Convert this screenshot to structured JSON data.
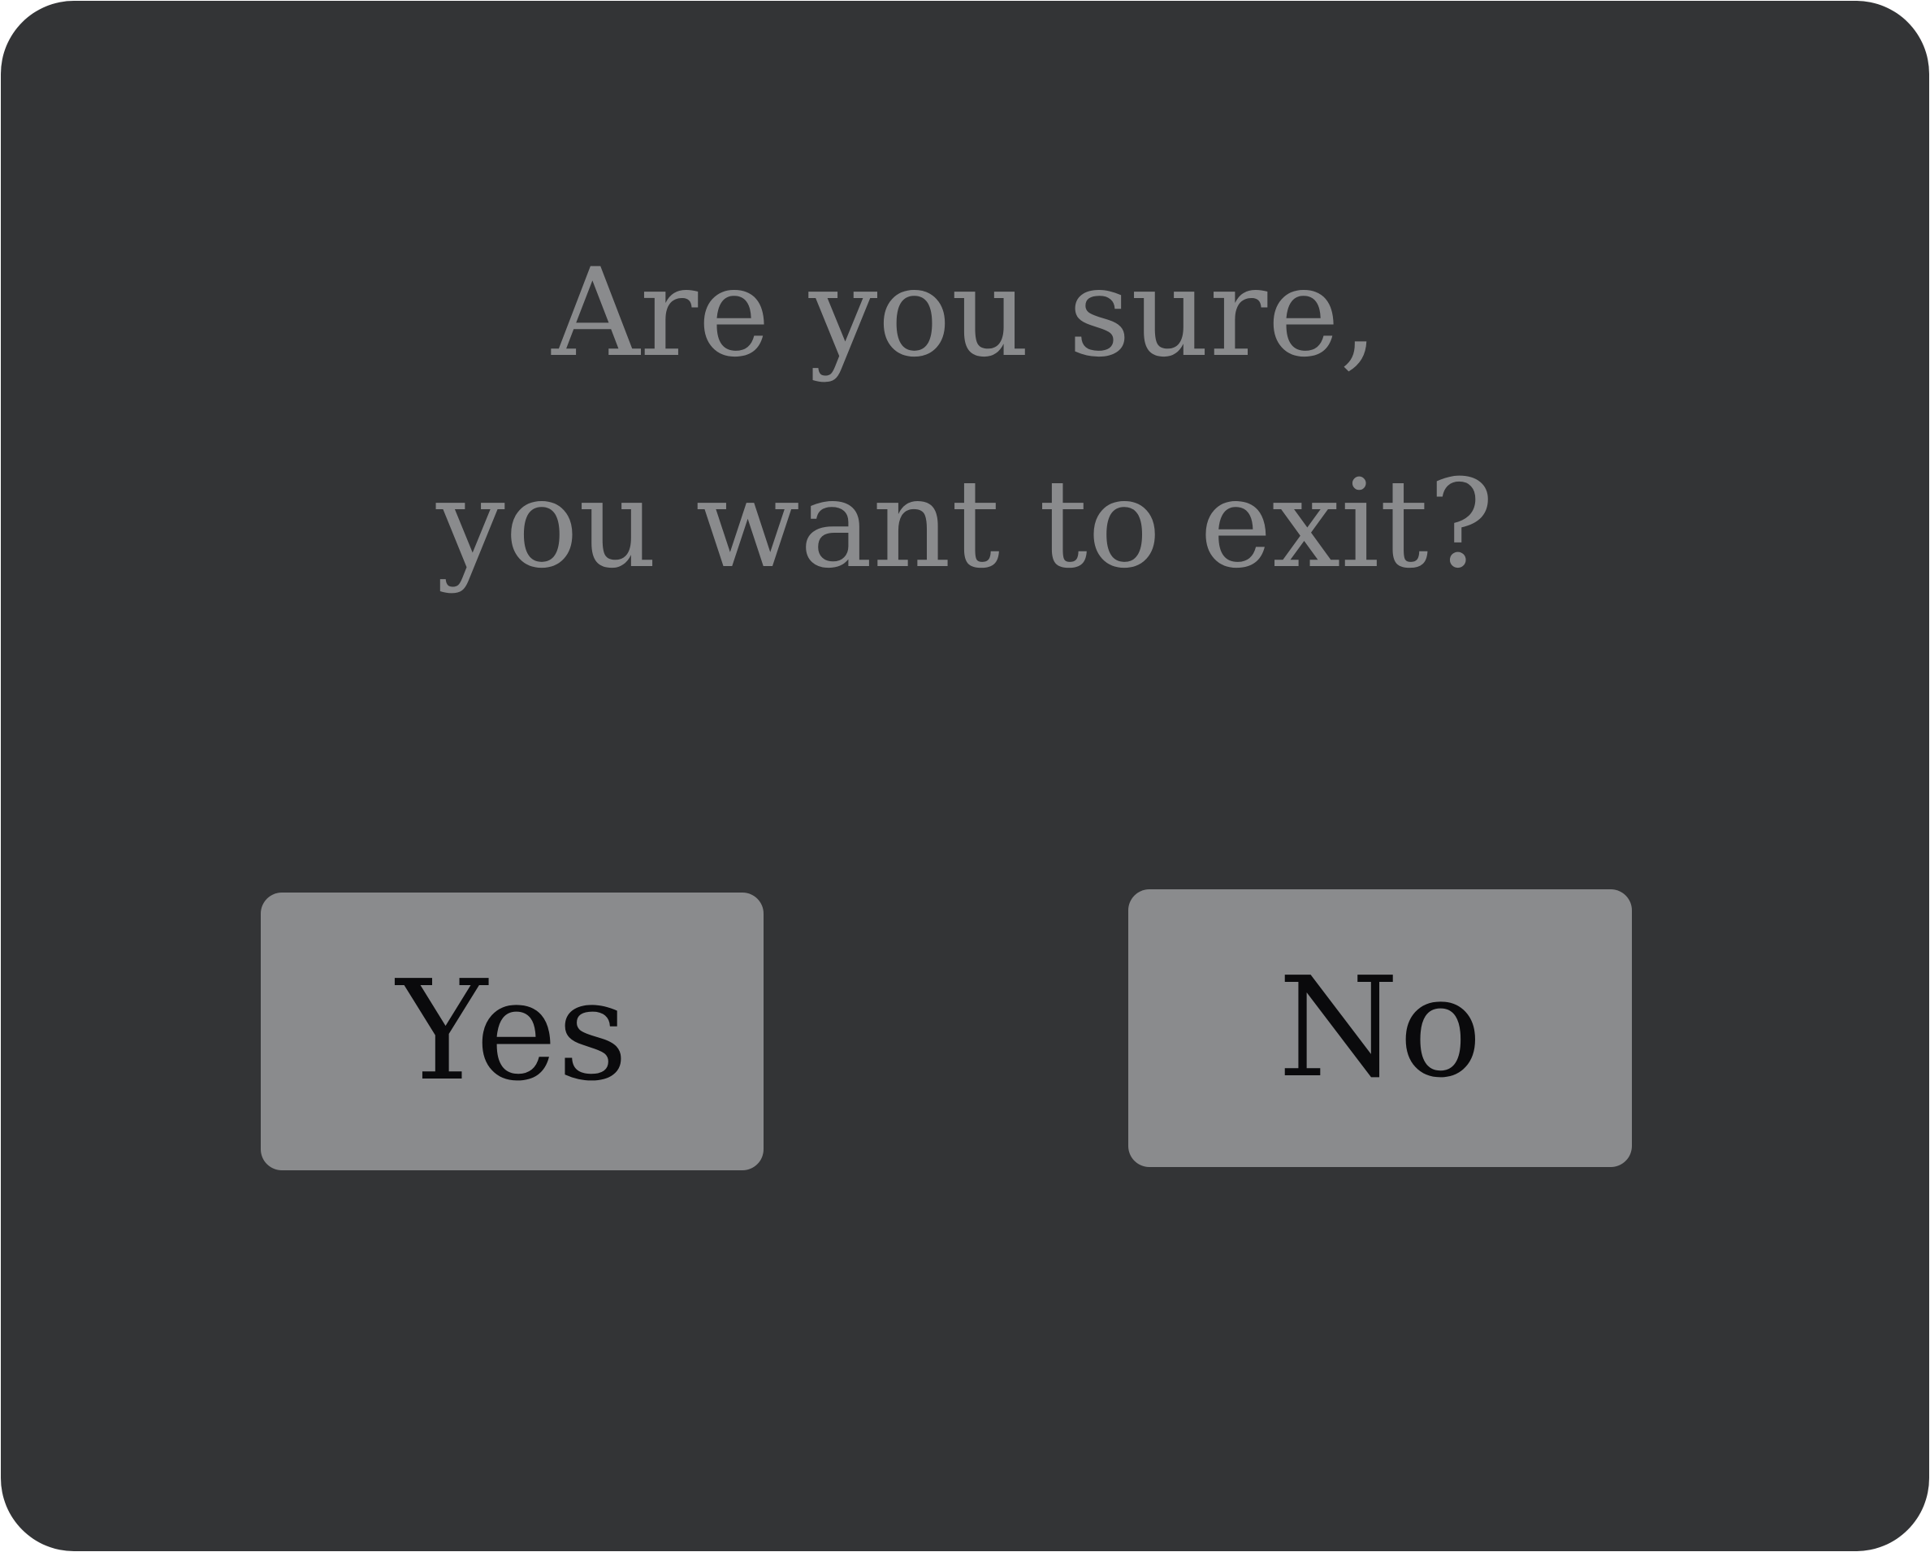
{
  "dialog": {
    "message_line1": "Are you sure,",
    "message_line2": "you want to exit?",
    "yes_label": "Yes",
    "no_label": "No"
  },
  "colors": {
    "background": "#333436",
    "text": "#8a8b8d",
    "button": "#8a8b8d",
    "button_text": "#0a0a0c"
  }
}
